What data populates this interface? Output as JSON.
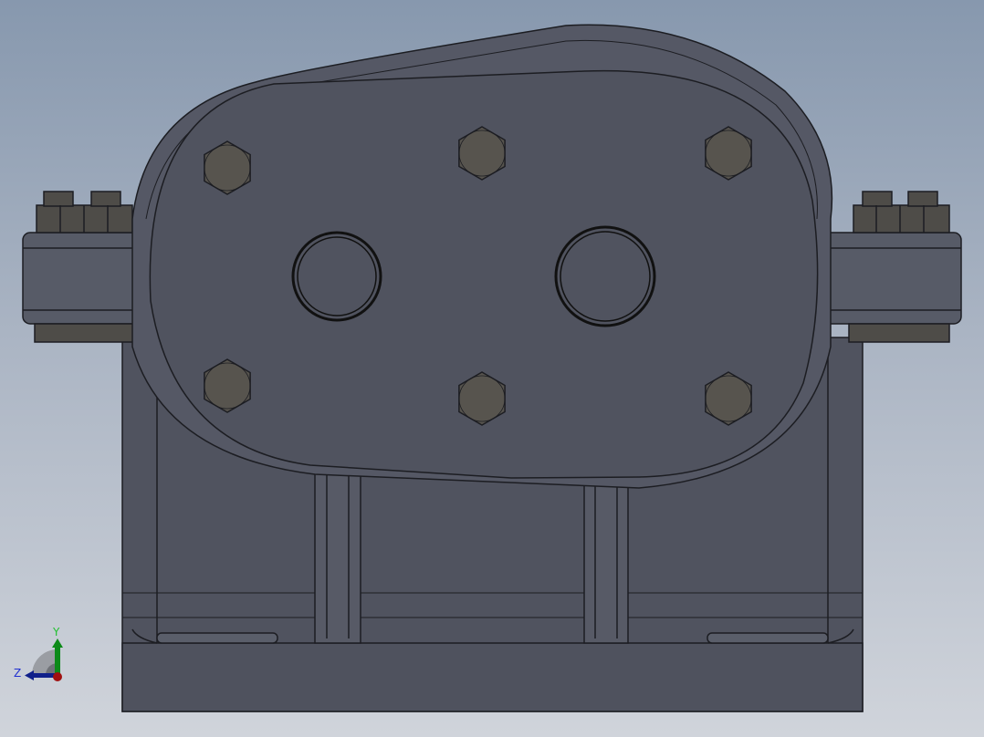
{
  "viewport": {
    "model": "gearbox-assembly",
    "colors": {
      "body": "#50535f",
      "body_light": "#5e6270",
      "edge": "#1c1d22",
      "bolt": "#57544e",
      "background_top": "#8798ae",
      "background_bottom": "#d0d4db"
    }
  },
  "triad": {
    "y_label": "Y",
    "z_label": "Z",
    "x_color": "#d01010",
    "y_color": "#0c8a18",
    "z_color": "#10208a"
  }
}
